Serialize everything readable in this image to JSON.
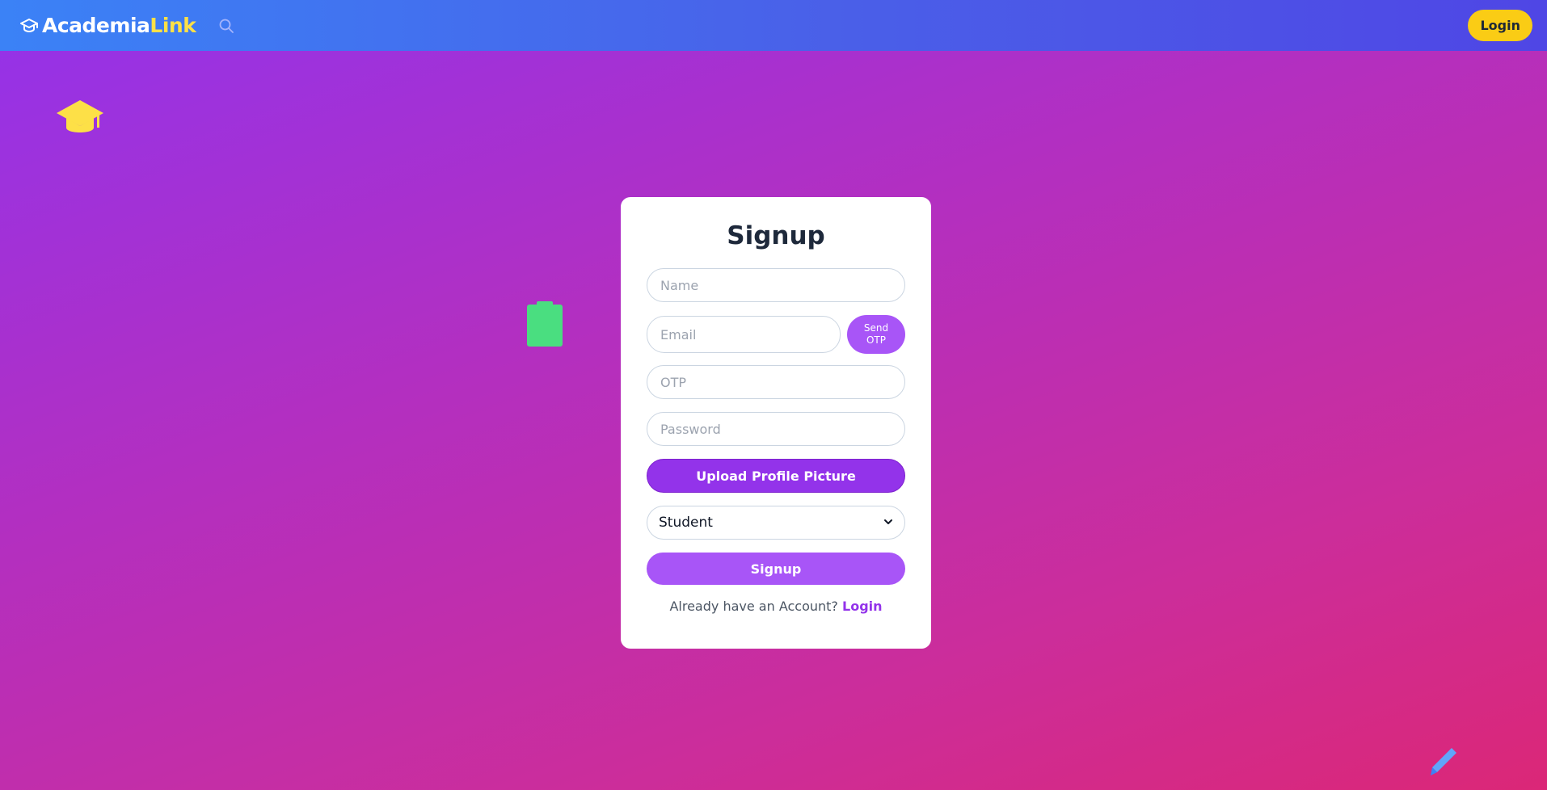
{
  "navbar": {
    "brand_main": "Academia",
    "brand_accent": "Link",
    "login_label": "Login"
  },
  "form": {
    "title": "Signup",
    "name_placeholder": "Name",
    "email_placeholder": "Email",
    "send_otp_label": "Send\nOTP",
    "otp_placeholder": "OTP",
    "password_placeholder": "Password",
    "upload_label": "Upload Profile Picture",
    "role_selected": "Student",
    "submit_label": "Signup",
    "footer_prompt": "Already have an Account?",
    "footer_link": "Login"
  },
  "colors": {
    "brand_accent": "#fde047",
    "primary": "#9333ea",
    "secondary": "#a855f7",
    "login_button": "#facc15"
  },
  "icons": {
    "brand": "graduation-cap-icon",
    "search": "search-icon",
    "select": "chevron-down-icon",
    "deco_cap": "graduation-cap-icon",
    "deco_clipboard": "clipboard-icon",
    "deco_pen": "pen-icon"
  }
}
